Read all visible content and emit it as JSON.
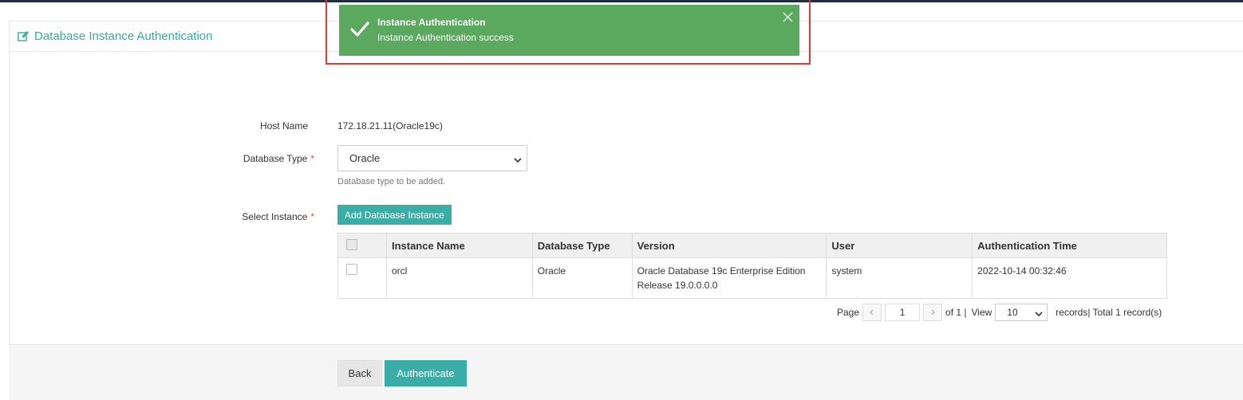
{
  "panel": {
    "title": "Database Instance Authentication",
    "title_icon": "edit-icon"
  },
  "form": {
    "host_name_label": "Host Name",
    "host_name_value": "172.18.21.11(Oracle19c)",
    "db_type_label": "Database Type",
    "db_type_value": "Oracle",
    "db_type_help": "Database type to be added.",
    "required_mark": "*",
    "select_instance_label": "Select Instance",
    "add_instance_button": "Add Database Instance"
  },
  "table": {
    "headers": [
      "Instance Name",
      "Database Type",
      "Version",
      "User",
      "Authentication Time"
    ],
    "rows": [
      {
        "instance_name": "orcl",
        "database_type": "Oracle",
        "version": "Oracle Database 19c Enterprise Edition Release 19.0.0.0.0",
        "user": "system",
        "auth_time": "2022-10-14 00:32:46"
      }
    ]
  },
  "pager": {
    "page_label": "Page",
    "page_value": "1",
    "of_label": "of 1 |",
    "view_label": "View",
    "page_size": "10",
    "records_label": "records",
    "total_label": "| Total 1 record(s)"
  },
  "footer": {
    "back_button": "Back",
    "authenticate_button": "Authenticate"
  },
  "toast": {
    "title": "Instance Authentication",
    "message": "Instance Authentication success"
  },
  "colors": {
    "accent": "#3aada6",
    "toast_bg": "#5ba95e",
    "highlight": "#e53935",
    "required": "#e74c3c"
  }
}
